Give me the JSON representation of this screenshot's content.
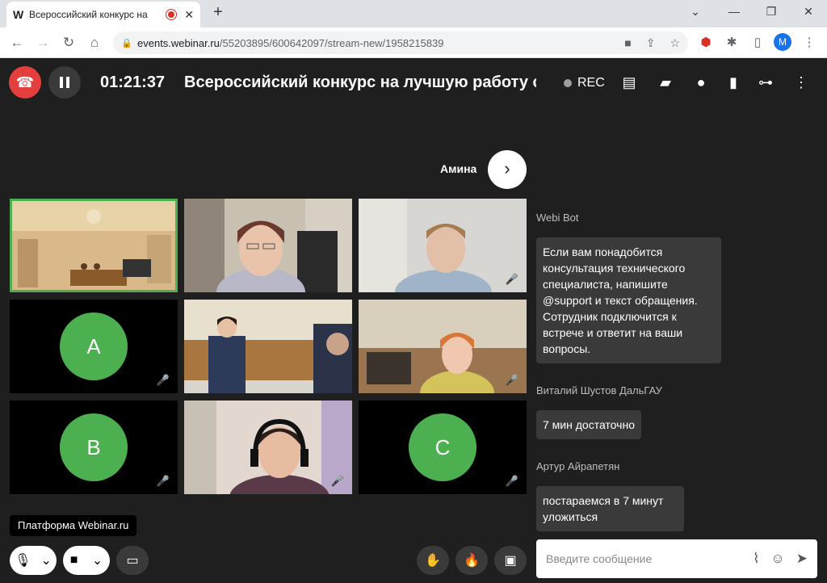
{
  "browser": {
    "tab_favicon": "W",
    "tab_title": "Всероссийский конкурс на",
    "url_host": "events.webinar.ru",
    "url_path": "/55203895/600642097/stream-new/1958215839",
    "profile_initial": "M"
  },
  "topbar": {
    "timer": "01:21:37",
    "event_title": "Всероссийский конкурс на лучшую работу среди",
    "rec_label": "REC"
  },
  "speaker": {
    "name": "Амина"
  },
  "tiles": [
    {
      "kind": "video",
      "scene": "hall",
      "active": true,
      "muted": false
    },
    {
      "kind": "video",
      "scene": "woman-glasses",
      "active": false,
      "muted": false
    },
    {
      "kind": "video",
      "scene": "blurred-man",
      "active": false,
      "muted": true
    },
    {
      "kind": "avatar",
      "letter": "A",
      "active": false,
      "muted": true
    },
    {
      "kind": "video",
      "scene": "office-standing",
      "active": false,
      "muted": false
    },
    {
      "kind": "video",
      "scene": "woman-yellow",
      "active": false,
      "muted": true
    },
    {
      "kind": "avatar",
      "letter": "B",
      "active": false,
      "muted": true
    },
    {
      "kind": "video",
      "scene": "man-headphones",
      "active": false,
      "muted": true
    },
    {
      "kind": "avatar",
      "letter": "C",
      "active": false,
      "muted": true
    }
  ],
  "platform_label": "Платформа Webinar.ru",
  "chat": {
    "messages": [
      {
        "author": "Webi Bot",
        "lines": [
          "Если вам понадобится",
          "консультация технического",
          "специалиста, напишите",
          "@support и текст обращения.",
          "Сотрудник подключится к",
          "встрече и ответит на ваши",
          "вопросы."
        ]
      },
      {
        "author": "Виталий Шустов ДальГАУ",
        "lines": [
          "7 мин достаточно"
        ]
      },
      {
        "author": "Артур Айрапетян",
        "lines": [
          "постараемся в 7 минут",
          "уложиться"
        ]
      }
    ],
    "input_placeholder": "Введите сообщение"
  },
  "colors": {
    "accent_green": "#4caf50",
    "hangup_red": "#e53e3e",
    "background": "#1f1f1f"
  }
}
